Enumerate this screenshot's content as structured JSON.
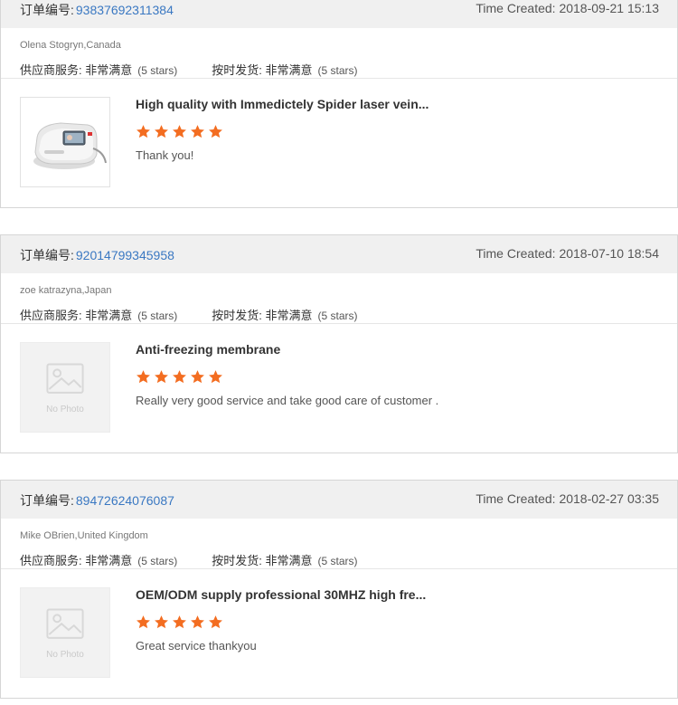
{
  "labels": {
    "order_prefix": "订单编号:",
    "time_prefix": "Time Created:",
    "supplier_service": "供应商服务:",
    "on_time_delivery": "按时发货:",
    "no_photo": "No Photo"
  },
  "colors": {
    "header_bg": "#f0f0f0",
    "link_blue": "#3a78c2",
    "star_orange": "#f36d21",
    "border": "#d6d6d6"
  },
  "reviews": [
    {
      "order_number": "93837692311384",
      "time_created": "2018-09-21 15:13",
      "reviewer": "Olena Stogryn,Canada",
      "supplier_service_value": "非常满意",
      "supplier_service_stars": "(5 stars)",
      "on_time_delivery_value": "非常满意",
      "on_time_delivery_stars": "(5 stars)",
      "product_title": "High quality with Immedictely Spider laser vein...",
      "rating": 5,
      "feedback": "Thank you!",
      "thumbnail": "laser-device-photo"
    },
    {
      "order_number": "92014799345958",
      "time_created": "2018-07-10 18:54",
      "reviewer": "zoe katrazyna,Japan",
      "supplier_service_value": "非常满意",
      "supplier_service_stars": "(5 stars)",
      "on_time_delivery_value": "非常满意",
      "on_time_delivery_stars": "(5 stars)",
      "product_title": "Anti-freezing membrane",
      "rating": 5,
      "feedback": "Really very good service and take good care of customer .",
      "thumbnail": "no-photo-placeholder"
    },
    {
      "order_number": "89472624076087",
      "time_created": "2018-02-27 03:35",
      "reviewer": "Mike OBrien,United Kingdom",
      "supplier_service_value": "非常满意",
      "supplier_service_stars": "(5 stars)",
      "on_time_delivery_value": "非常满意",
      "on_time_delivery_stars": "(5 stars)",
      "product_title": "OEM/ODM supply professional 30MHZ high fre...",
      "rating": 5,
      "feedback": "Great service thankyou",
      "thumbnail": "no-photo-placeholder"
    }
  ]
}
